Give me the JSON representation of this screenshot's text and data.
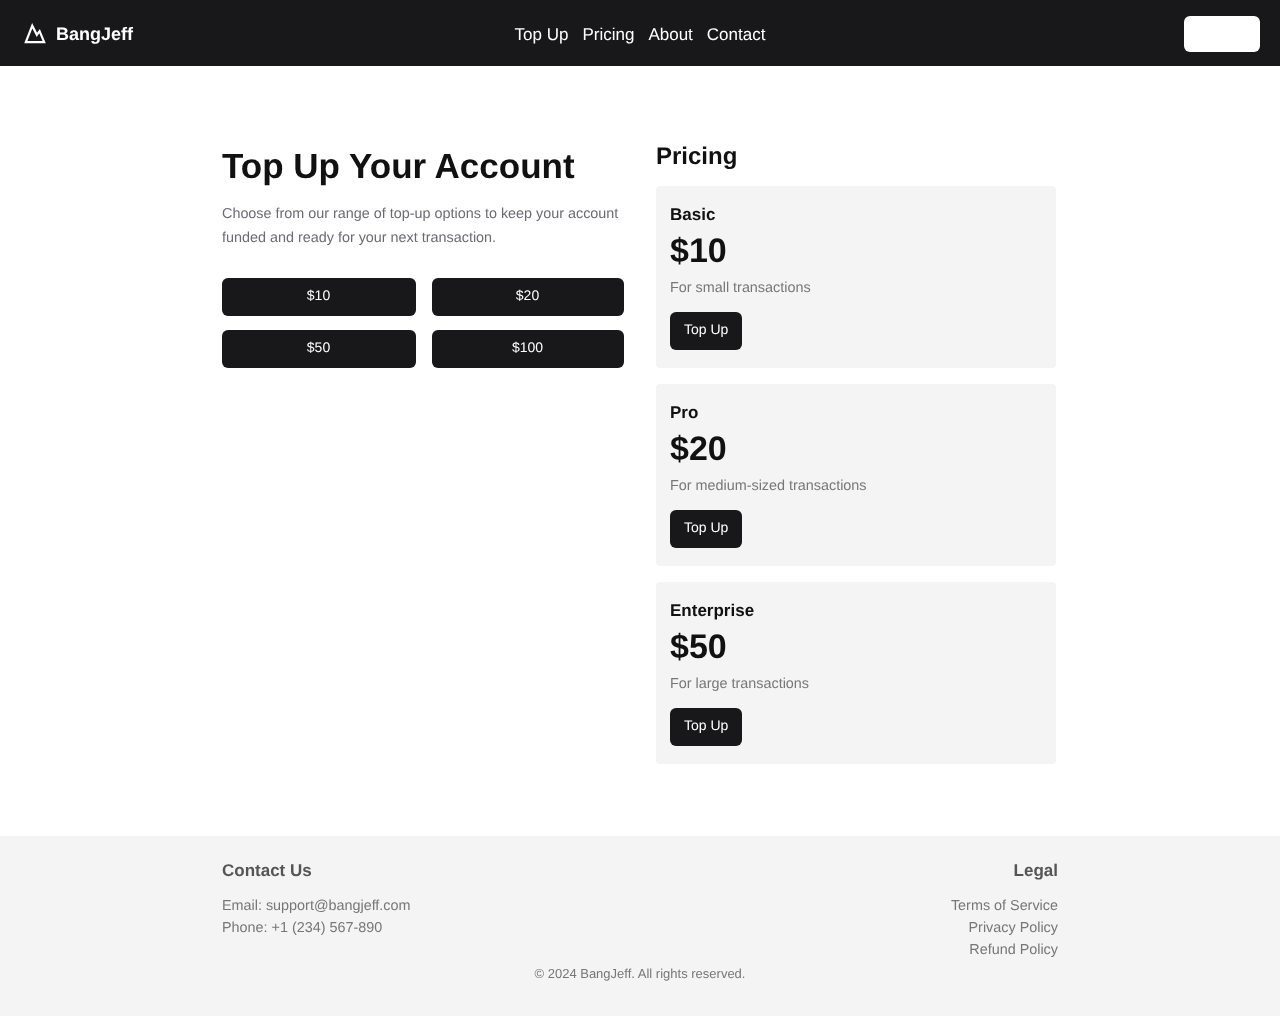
{
  "header": {
    "brand": "BangJeff",
    "nav": [
      "Top Up",
      "Pricing",
      "About",
      "Contact"
    ]
  },
  "topup": {
    "title": "Top Up Your Account",
    "description": "Choose from our range of top-up options to keep your account funded and ready for your next transaction.",
    "amounts": [
      "$10",
      "$20",
      "$50",
      "$100"
    ]
  },
  "pricing": {
    "title": "Pricing",
    "plans": [
      {
        "name": "Basic",
        "price": "$10",
        "note": "For small transactions",
        "button": "Top Up"
      },
      {
        "name": "Pro",
        "price": "$20",
        "note": "For medium-sized transactions",
        "button": "Top Up"
      },
      {
        "name": "Enterprise",
        "price": "$50",
        "note": "For large transactions",
        "button": "Top Up"
      }
    ]
  },
  "footer": {
    "contact_title": "Contact Us",
    "contact_lines": [
      "Email: support@bangjeff.com",
      "Phone: +1 (234) 567-890"
    ],
    "legal_title": "Legal",
    "legal_links": [
      "Terms of Service",
      "Privacy Policy",
      "Refund Policy"
    ],
    "copyright": "© 2024 BangJeff. All rights reserved."
  }
}
